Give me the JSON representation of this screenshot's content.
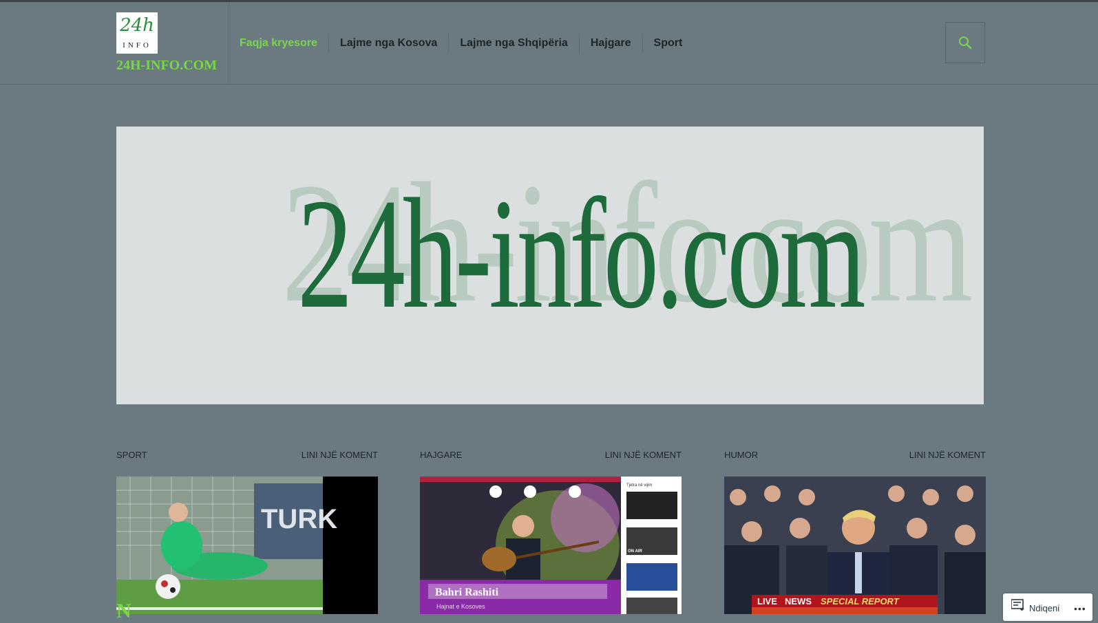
{
  "site": {
    "logo_top": "24h",
    "logo_bottom": "INFO",
    "title": "24H-INFO.COM"
  },
  "nav": {
    "items": [
      {
        "label": "Faqja kryesore",
        "active": true
      },
      {
        "label": "Lajme nga Kosova",
        "active": false
      },
      {
        "label": "Lajme nga Shqipëria",
        "active": false
      },
      {
        "label": "Hajgare",
        "active": false
      },
      {
        "label": "Sport",
        "active": false
      }
    ],
    "search_icon": "search-icon"
  },
  "banner": {
    "text": "24h-info.com"
  },
  "cards": [
    {
      "category": "SPORT",
      "comment": "LINI NJË KOMENT",
      "headline": "N"
    },
    {
      "category": "HAJGARE",
      "comment": "LINI NJË KOMENT",
      "thumb_next": "Tjetra në vijim",
      "thumb_caption": "Bahri Rashiti",
      "thumb_subcaption": "Hajnat e Kosoves",
      "thumb_onair": "ON AIR"
    },
    {
      "category": "HUMOR",
      "comment": "LINI NJË KOMENT",
      "thumb_live": "LIVE",
      "thumb_news": "NEWS",
      "thumb_special": "SPECIAL REPORT"
    }
  ],
  "follow": {
    "label": "Ndiqeni",
    "more": "•••"
  },
  "colors": {
    "background": "#6b7a80",
    "accent": "#79d64b",
    "banner_bg": "#dcdfe0",
    "banner_text": "#1d6b3a"
  }
}
